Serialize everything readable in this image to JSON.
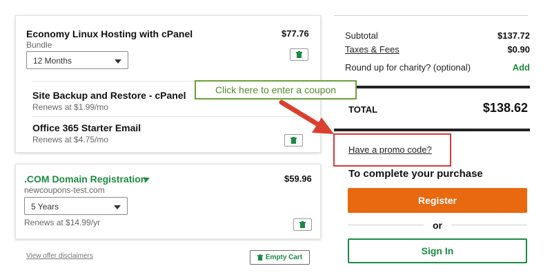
{
  "cart": {
    "product1": {
      "name": "Economy Linux Hosting with cPanel",
      "type": "Bundle",
      "price": "$77.76",
      "term": "12 Months"
    },
    "addons": [
      {
        "name": "Site Backup and Restore - cPanel",
        "renew": "Renews at $1.99/mo"
      },
      {
        "name": "Office 365 Starter Email",
        "renew": "Renews at $4.75/mo"
      }
    ],
    "domain": {
      "name": ".COM Domain Registration",
      "domain": "newcoupons-test.com",
      "price": "$59.96",
      "term": "5 Years",
      "renew": "Renews at $14.99/yr"
    },
    "disclaimer_link": "View offer disclaimers",
    "empty_cart_label": "Empty Cart"
  },
  "summary": {
    "subtotal_label": "Subtotal",
    "subtotal_value": "$137.72",
    "taxes_label": "Taxes & Fees",
    "taxes_value": "$0.90",
    "charity_label": "Round up for charity? (optional)",
    "charity_action": "Add",
    "total_label": "TOTAL",
    "total_value": "$138.62",
    "promo_link": "Have a promo code?",
    "complete_heading": "To complete your purchase",
    "register_label": "Register",
    "or_label": "or",
    "signin_label": "Sign In"
  },
  "annotation": {
    "callout_text": "Click here to enter a coupon"
  },
  "colors": {
    "green": "#1b8a43",
    "orange": "#e8690f",
    "highlight_red": "#d13c3c",
    "callout_green": "#6aa039"
  },
  "icons": {
    "trash": "trash-icon",
    "dropdown": "chevron-down-icon"
  }
}
